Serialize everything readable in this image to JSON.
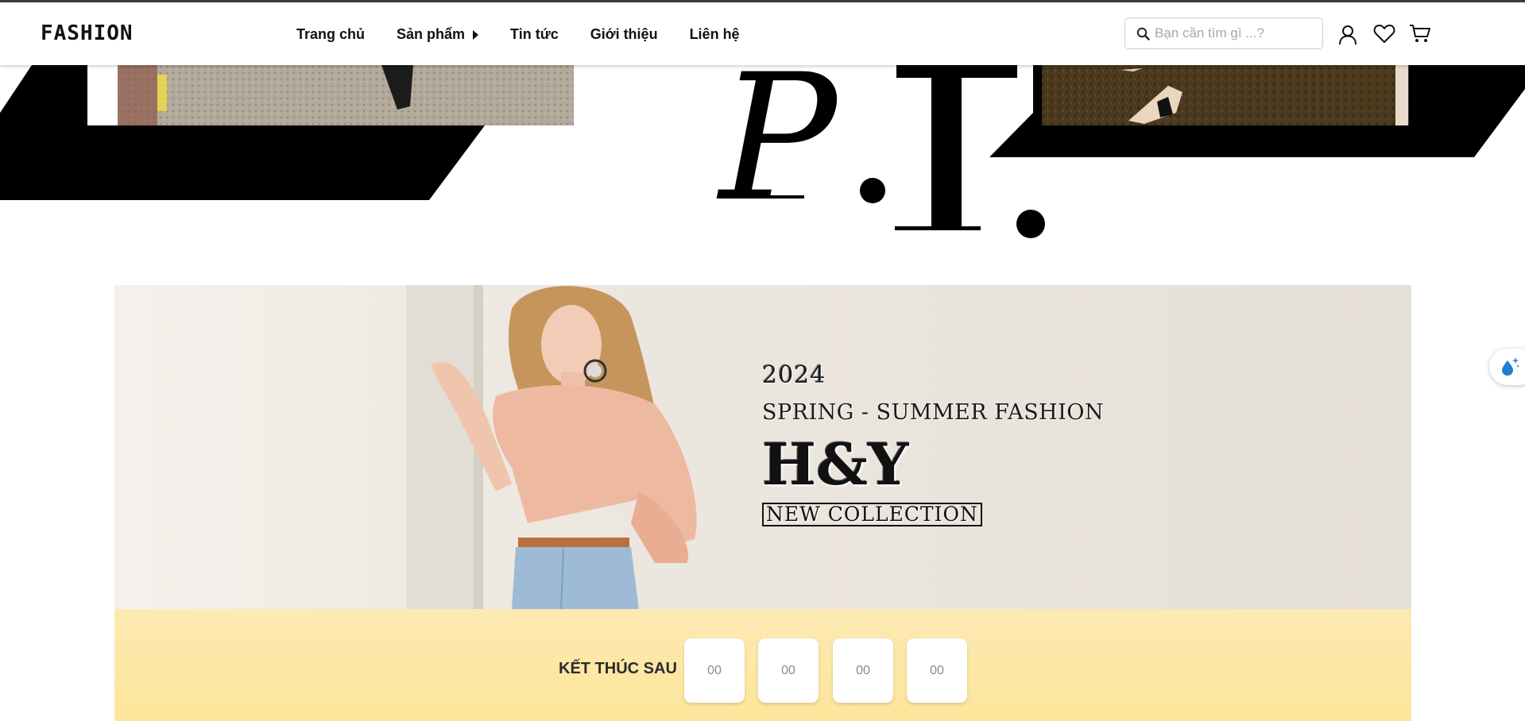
{
  "header": {
    "logo": "FASHION",
    "nav": [
      {
        "label": "Trang chủ",
        "has_submenu": false
      },
      {
        "label": "Sản phẩm",
        "has_submenu": true
      },
      {
        "label": "Tin tức",
        "has_submenu": false
      },
      {
        "label": "Giới thiệu",
        "has_submenu": false
      },
      {
        "label": "Liên hệ",
        "has_submenu": false
      }
    ],
    "search": {
      "placeholder": "Bạn cần tìm gì ...?",
      "value": "",
      "icon": "search-icon"
    },
    "icons": [
      "user-icon",
      "heart-icon",
      "cart-icon"
    ]
  },
  "hero_top": {
    "decor_letters": "P.T."
  },
  "banner": {
    "year": "2024",
    "subtitle": "SPRING - SUMMER FASHION",
    "brand": "H&Y",
    "collection": "NEW COLLECTION"
  },
  "countdown": {
    "label": "KẾT THÚC SAU",
    "units": [
      "00",
      "00",
      "00",
      "00"
    ]
  },
  "floating_widget": {
    "icon": "water-drop-sparkle-icon"
  },
  "colors": {
    "countdown_bg": "#fde69a",
    "banner_bg": "#ece7df",
    "header_border": "#3a3a3a",
    "text_dark": "#111111"
  }
}
